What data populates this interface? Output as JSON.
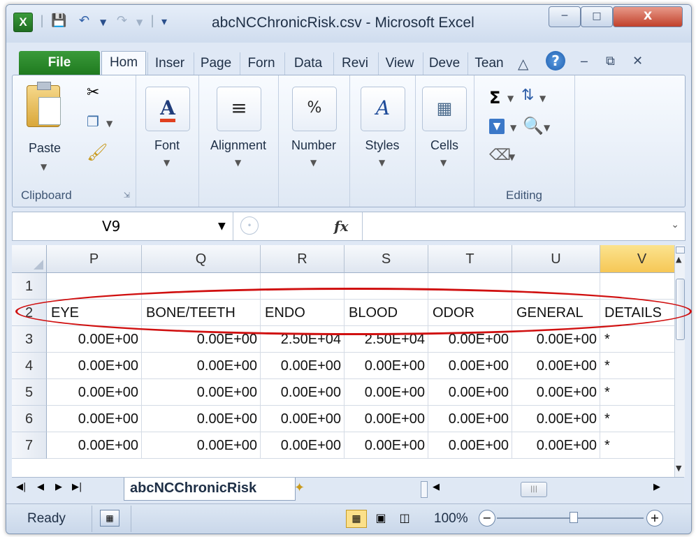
{
  "window": {
    "title": "abcNCChronicRisk.csv  -  Microsoft Excel",
    "app_icon_letter": "X",
    "close_label": "X"
  },
  "ribbon_tabs": [
    "File",
    "Hom",
    "Inser",
    "Page",
    "Forn",
    "Data",
    "Revi",
    "View",
    "Deve",
    "Tean"
  ],
  "ribbon": {
    "paste_label": "Paste",
    "clipboard_group": "Clipboard",
    "font_label": "Font",
    "alignment_label": "Alignment",
    "number_label": "Number",
    "styles_label": "Styles",
    "cells_label": "Cells",
    "editing_group": "Editing"
  },
  "formula_bar": {
    "name_box": "V9",
    "fx_label": "fx",
    "formula": ""
  },
  "columns": [
    "P",
    "Q",
    "R",
    "S",
    "T",
    "U",
    "V"
  ],
  "selected_column": "V",
  "rows": [
    {
      "num": "1",
      "cells": [
        "",
        "",
        "",
        "",
        "",
        "",
        ""
      ]
    },
    {
      "num": "2",
      "cells": [
        "EYE",
        "BONE/TEETH",
        "ENDO",
        "BLOOD",
        "ODOR",
        "GENERAL",
        "DETAILS"
      ]
    },
    {
      "num": "3",
      "cells": [
        "0.00E+00",
        "0.00E+00",
        "2.50E+04",
        "2.50E+04",
        "0.00E+00",
        "0.00E+00",
        "*"
      ]
    },
    {
      "num": "4",
      "cells": [
        "0.00E+00",
        "0.00E+00",
        "0.00E+00",
        "0.00E+00",
        "0.00E+00",
        "0.00E+00",
        "*"
      ]
    },
    {
      "num": "5",
      "cells": [
        "0.00E+00",
        "0.00E+00",
        "0.00E+00",
        "0.00E+00",
        "0.00E+00",
        "0.00E+00",
        "*"
      ]
    },
    {
      "num": "6",
      "cells": [
        "0.00E+00",
        "0.00E+00",
        "0.00E+00",
        "0.00E+00",
        "0.00E+00",
        "0.00E+00",
        "*"
      ]
    },
    {
      "num": "7",
      "cells": [
        "0.00E+00",
        "0.00E+00",
        "0.00E+00",
        "0.00E+00",
        "0.00E+00",
        "0.00E+00",
        "*"
      ]
    }
  ],
  "sheet_tab": "abcNCChronicRisk",
  "status": {
    "ready": "Ready",
    "zoom": "100%"
  },
  "colors": {
    "annotation_ellipse": "#d01010",
    "file_tab": "#1f7a1f",
    "selected_column_header": "#f6c756"
  }
}
